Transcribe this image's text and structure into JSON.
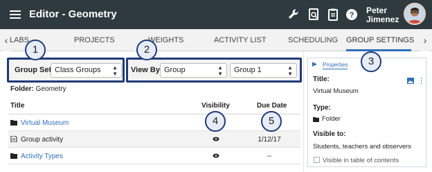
{
  "header": {
    "title": "Editor - Geometry",
    "user_first": "Peter",
    "user_last": "Jimenez",
    "icons": [
      "menu-icon",
      "wrench-icon",
      "search-doc-icon",
      "clipboard-icon",
      "help-icon"
    ],
    "bg_color": "#2f3a40"
  },
  "tabs": {
    "items": [
      {
        "label": "LABS"
      },
      {
        "label": "PROJECTS"
      },
      {
        "label": "WEIGHTS"
      },
      {
        "label": "ACTIVITY LIST"
      },
      {
        "label": "SCHEDULING"
      },
      {
        "label": "GROUP SETTINGS"
      }
    ],
    "active": "GROUP SETTINGS",
    "prev_arrow": "‹",
    "next_arrow": "›",
    "accent": "#2f6fb5"
  },
  "group_set": {
    "label": "Group Set:",
    "selected": "Class Groups"
  },
  "view_by": {
    "label": "View By:",
    "selected": "Group",
    "group_selected": "Group 1"
  },
  "folder": {
    "label": "Folder:",
    "name": "Geometry"
  },
  "table": {
    "headers": {
      "title": "Title",
      "visibility": "Visibility",
      "due": "Due Date"
    },
    "rows": [
      {
        "icon": "folder-icon",
        "title": "Virtual Museum",
        "link": true,
        "visible": false,
        "due": ""
      },
      {
        "icon": "document-icon",
        "title": "Group activity",
        "link": false,
        "visible": true,
        "due": "1/12/17"
      },
      {
        "icon": "folder-icon",
        "title": "Activity Types",
        "link": true,
        "visible": true,
        "due": "--"
      }
    ]
  },
  "properties": {
    "tab": "Properties",
    "title_label": "Title:",
    "title_value": "Virtual Museum",
    "type_label": "Type:",
    "type_value": "Folder",
    "visible_label": "Visible to:",
    "visible_value": "Students, teachers and observers",
    "toc_label": "Visible in table of contents"
  },
  "callouts": [
    "1",
    "2",
    "3",
    "4",
    "5"
  ],
  "colors": {
    "callout_border": "#1f3a78",
    "callout_fill": "#e7ecf7",
    "link": "#2f6fb5"
  }
}
